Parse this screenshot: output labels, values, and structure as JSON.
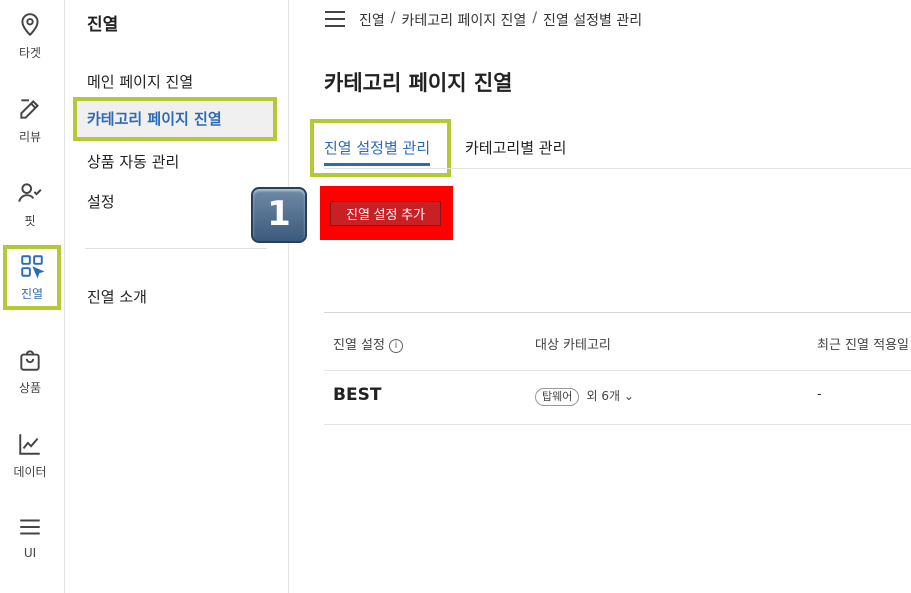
{
  "rail": {
    "items": [
      {
        "label": "타겟",
        "icon": "location-pin-icon"
      },
      {
        "label": "리뷰",
        "icon": "edit-icon"
      },
      {
        "label": "핏",
        "icon": "user-check-icon"
      },
      {
        "label": "진열",
        "icon": "grid-cursor-icon"
      },
      {
        "label": "상품",
        "icon": "shopping-bag-icon"
      },
      {
        "label": "데이터",
        "icon": "chart-line-icon"
      },
      {
        "label": "UI",
        "icon": "menu-icon"
      }
    ]
  },
  "sidebar": {
    "title": "진열",
    "items": [
      "메인 페이지 진열",
      "카테고리 페이지 진열",
      "상품 자동 관리",
      "설정"
    ],
    "footer_item": "진열 소개"
  },
  "breadcrumb": [
    "진열",
    "카테고리 페이지 진열",
    "진열 설정별 관리"
  ],
  "breadcrumb_sep": "/",
  "page_title": "카테고리 페이지 진열",
  "tabs": [
    "진열 설정별 관리",
    "카테고리별 관리"
  ],
  "add_button": "진열 설정 추가",
  "step_badge": "1",
  "table": {
    "headers": [
      "진열 설정",
      "대상 카테고리",
      "최근 진열 적용일"
    ],
    "info_icon": "i",
    "rows": [
      {
        "name": "BEST",
        "category_chip": "탑웨어",
        "category_more": "외 6개",
        "last_applied": "-"
      }
    ]
  },
  "colors": {
    "accent": "#2d6ab8",
    "highlight": "#b5c934",
    "button": "#c92026"
  }
}
